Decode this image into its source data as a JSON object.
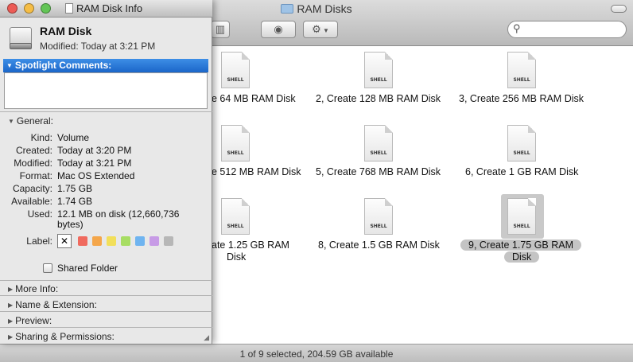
{
  "finder": {
    "title": "RAM Disks",
    "status": "1 of 9 selected, 204.59 GB available",
    "items": [
      {
        "label": "e 64 MB RAM Disk"
      },
      {
        "label": "2, Create 128 MB RAM Disk"
      },
      {
        "label": "3, Create 256 MB RAM Disk"
      },
      {
        "label": "e 512 MB RAM Disk"
      },
      {
        "label": "5, Create 768 MB RAM Disk"
      },
      {
        "label": "6, Create 1 GB RAM Disk"
      },
      {
        "label_line1": "ate 1.25 GB RAM",
        "label_line2": "Disk"
      },
      {
        "label": "8, Create 1.5 GB RAM Disk"
      },
      {
        "label_line1": "9, Create 1.75 GB RAM",
        "label_line2": "Disk",
        "selected": true
      }
    ],
    "icon_badge": "SHELL"
  },
  "info": {
    "title": "RAM Disk Info",
    "disk_name": "RAM Disk",
    "modified_line": "Modified: Today at 3:21 PM",
    "spotlight_header": "Spotlight Comments:",
    "general_header": "General:",
    "general": [
      {
        "key": "Kind:",
        "value": "Volume"
      },
      {
        "key": "Created:",
        "value": "Today at 3:20 PM"
      },
      {
        "key": "Modified:",
        "value": "Today at 3:21 PM"
      },
      {
        "key": "Format:",
        "value": "Mac OS Extended"
      },
      {
        "key": "Capacity:",
        "value": "1.75 GB"
      },
      {
        "key": "Available:",
        "value": "1.74 GB"
      },
      {
        "key": "Used:",
        "value": "12.1 MB on disk (12,660,736",
        "value2": "bytes)"
      }
    ],
    "label_key": "Label:",
    "label_none": "✕",
    "label_colors": [
      "#f06a5e",
      "#f4a64a",
      "#f2df5a",
      "#a7dd63",
      "#6fb4f0",
      "#c79be6",
      "#b7b7b7"
    ],
    "shared_folder_label": "Shared Folder",
    "sections": [
      "More Info:",
      "Name & Extension:",
      "Preview:",
      "Sharing & Permissions:"
    ]
  },
  "colors": {
    "traffic_red": "#ec5b55",
    "traffic_yellow": "#f5bd45",
    "traffic_green": "#63c556",
    "selection_blue": "#1b66c9"
  }
}
